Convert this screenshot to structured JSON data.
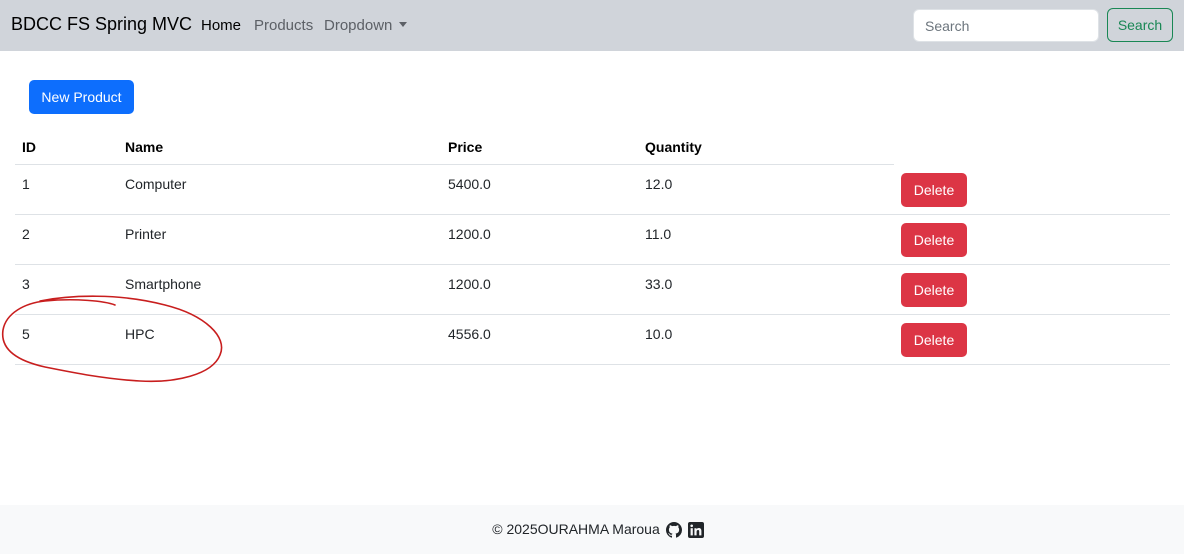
{
  "navbar": {
    "brand": "BDCC FS Spring MVC",
    "links": {
      "home": "Home",
      "products": "Products",
      "dropdown": "Dropdown"
    },
    "search": {
      "placeholder": "Search",
      "button_label": "Search"
    }
  },
  "actions": {
    "new_product_label": "New Product"
  },
  "table": {
    "headers": {
      "id": "ID",
      "name": "Name",
      "price": "Price",
      "quantity": "Quantity"
    },
    "rows": [
      {
        "id": "1",
        "name": "Computer",
        "price": "5400.0",
        "quantity": "12.0",
        "action": "Delete"
      },
      {
        "id": "2",
        "name": "Printer",
        "price": "1200.0",
        "quantity": "11.0",
        "action": "Delete"
      },
      {
        "id": "3",
        "name": "Smartphone",
        "price": "1200.0",
        "quantity": "33.0",
        "action": "Delete"
      },
      {
        "id": "5",
        "name": "HPC",
        "price": "4556.0",
        "quantity": "10.0",
        "action": "Delete"
      }
    ]
  },
  "footer": {
    "text": "© 2025OURAHMA Maroua",
    "icons": [
      "github-icon",
      "linkedin-icon"
    ]
  },
  "colors": {
    "navbar_bg": "#d0d4da",
    "primary": "#0d6efd",
    "success": "#198754",
    "danger": "#dc3545",
    "annotation": "#c81e1e"
  }
}
